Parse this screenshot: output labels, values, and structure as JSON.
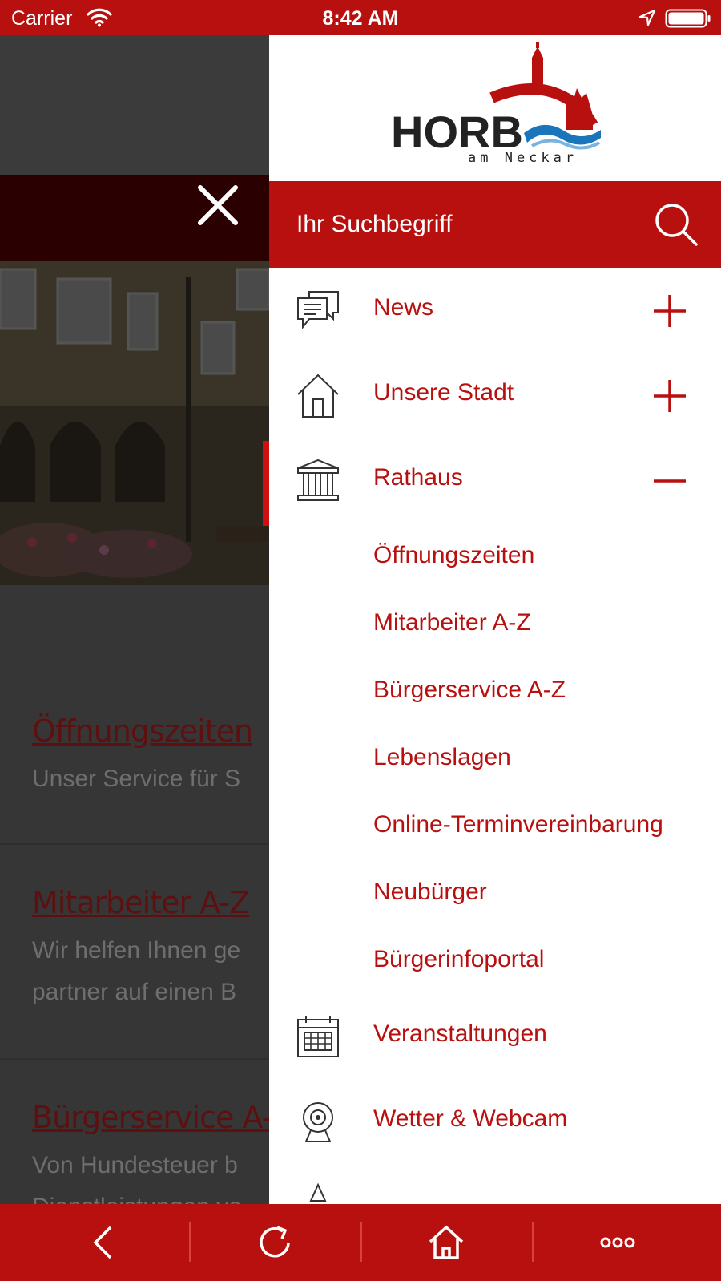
{
  "status_bar": {
    "carrier": "Carrier",
    "time": "8:42 AM",
    "wifi_icon": "wifi-icon",
    "location_icon": "location-arrow-icon",
    "battery_icon": "battery-full-icon"
  },
  "colors": {
    "brand_red": "#b8100f",
    "drawer_bg": "#ffffff",
    "overlay_dark": "#333333"
  },
  "background_page": {
    "close_icon": "close-icon",
    "items": [
      {
        "title": "Öffnungszeiten",
        "desc": [
          "Unser Service für S"
        ]
      },
      {
        "title": "Mitarbeiter A-Z",
        "desc": [
          "Wir helfen Ihnen ge",
          "partner auf einen B"
        ]
      },
      {
        "title": "Bürgerservice A-Z",
        "desc": [
          "Von Hundesteuer b",
          "Dienstleistungen vo"
        ]
      }
    ]
  },
  "drawer": {
    "logo": {
      "main": "HORB",
      "sub": "am Neckar"
    },
    "search": {
      "placeholder": "Ihr Suchbegriff",
      "icon": "search-icon"
    },
    "menu": [
      {
        "label": "News",
        "icon": "chat-bubbles-icon",
        "toggle": "plus-icon"
      },
      {
        "label": "Unsere Stadt",
        "icon": "house-icon",
        "toggle": "plus-icon"
      },
      {
        "label": "Rathaus",
        "icon": "town-hall-icon",
        "toggle": "minus-icon",
        "expanded": true
      }
    ],
    "submenu": [
      "Öffnungszeiten",
      "Mitarbeiter A-Z",
      "Bürgerservice A-Z",
      "Lebenslagen",
      "Online-Terminvereinbarung",
      "Neubürger",
      "Bürgerinfoportal"
    ],
    "menu_more": [
      {
        "label": "Veranstaltungen",
        "icon": "calendar-icon"
      },
      {
        "label": "Wetter & Webcam",
        "icon": "webcam-icon"
      }
    ]
  },
  "toolbar": {
    "buttons": [
      "back-icon",
      "reload-icon",
      "home-icon",
      "more-icon"
    ]
  }
}
